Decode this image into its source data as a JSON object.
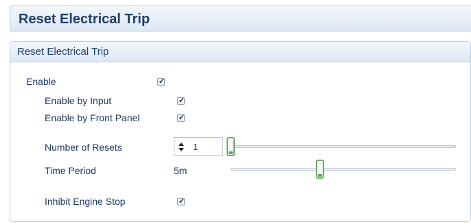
{
  "header": {
    "title": "Reset Electrical Trip"
  },
  "panel": {
    "title": "Reset Electrical Trip",
    "enable": {
      "label": "Enable",
      "checked": true
    },
    "enable_by_input": {
      "label": "Enable by Input",
      "checked": true
    },
    "enable_by_front_panel": {
      "label": "Enable by Front Panel",
      "checked": true
    },
    "number_of_resets": {
      "label": "Number of Resets",
      "value": "1",
      "slider_fraction": 0.0
    },
    "time_period": {
      "label": "Time Period",
      "value": "5m",
      "slider_fraction": 0.41
    },
    "inhibit_engine_stop": {
      "label": "Inhibit Engine Stop",
      "checked": true
    }
  },
  "colors": {
    "title_text": "#1e3f6a",
    "label_text": "#1e3a63",
    "border": "#b9cde4",
    "slider_thumb_accent": "#5da85a"
  },
  "icons": {
    "checkbox_tick": "✓",
    "spin_up": "spin-up-arrow",
    "spin_down": "spin-down-arrow"
  }
}
